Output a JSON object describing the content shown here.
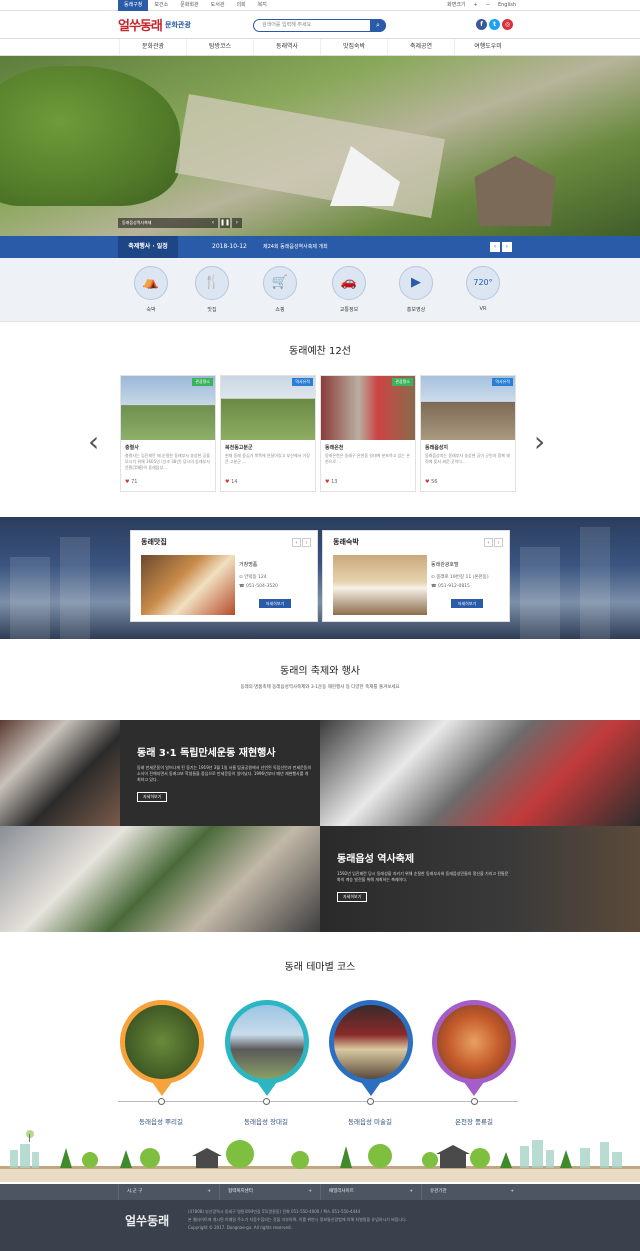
{
  "topbar": {
    "tabs": [
      "동래구청",
      "보건소",
      "문화회관",
      "도서관",
      "의회",
      "복지"
    ],
    "util": [
      "화면크기",
      "+",
      "−",
      "English"
    ]
  },
  "header": {
    "logo_script": "얼쑤동래",
    "logo_text": "문화관광",
    "search_placeholder": "검색어를 입력해 주세요",
    "search_icon": "search-icon",
    "sns": [
      {
        "label": "f",
        "color": "#3b5998"
      },
      {
        "label": "t",
        "color": "#1da1f2"
      },
      {
        "label": "◎",
        "color": "#d8333b"
      }
    ]
  },
  "gnb": [
    "문화관광",
    "탐방코스",
    "동래역사",
    "맛집숙박",
    "축제공연",
    "여행도우미"
  ],
  "hero": {
    "caption": "동래읍성역사축제",
    "controls": [
      "‹",
      "❚❚",
      "›"
    ]
  },
  "notice": {
    "label": "축제행사 · 일정",
    "date": "2018-10-12",
    "title": "제24회 동래읍성역사축제 개최",
    "arrows": [
      "‹",
      "›"
    ]
  },
  "quick": [
    {
      "label": "숙박",
      "icon": "⛺"
    },
    {
      "label": "맛집",
      "icon": "🍴"
    },
    {
      "label": "쇼핑",
      "icon": "🛒"
    },
    {
      "label": "교통정보",
      "icon": "🚗"
    },
    {
      "label": "홍보영상",
      "icon": "▶"
    },
    {
      "label": "VR",
      "icon": "720°"
    }
  ],
  "section_attractions": {
    "title": "동래예찬 12선",
    "cards": [
      {
        "badge": "관광명소",
        "badge_color": "#3bb25b",
        "name": "충렬사",
        "desc": "충렬사는 임진왜란 때 순절한 동래부사 송상현 공을 모시기 위해 1605년 (선조 38년) 당시의 동래부사 윤훤(尹暄)이 동래읍성...",
        "likes": "71",
        "img1": "#9bb8d9",
        "img2": "#6e8f4f"
      },
      {
        "badge": "역사유적",
        "badge_color": "#2a7fd4",
        "name": "복천동고분군",
        "desc": "현재 동래 중심가 북쪽에 연달아있고 부산에서 가장 큰 고분군 ...",
        "likes": "14",
        "img1": "#c9d6e3",
        "img2": "#6a8a45"
      },
      {
        "badge": "관광명소",
        "badge_color": "#3bb25b",
        "name": "동래온천",
        "desc": "동래온천은 동래구 온천동 일대에 분포하고 있는 온천으로 ...",
        "likes": "13",
        "img1": "#b9b0a0",
        "img2": "#8a3b3b"
      },
      {
        "badge": "역사유적",
        "badge_color": "#2a7fd4",
        "name": "동래읍성지",
        "desc": "동래읍성지는 동래부사 송상현 공이 군민과 함께 왜적에 맞서 싸운 곳이다...",
        "likes": "56",
        "img1": "#a7c1dd",
        "img2": "#7d6a55"
      }
    ]
  },
  "panels": [
    {
      "title": "동래맛집",
      "name": "거창명품",
      "addr": "안락동 124",
      "tel": "051-504-3520",
      "button": "자세히보기"
    },
    {
      "title": "동래숙박",
      "name": "동래관광호텔",
      "addr": "중래로 19번길 11 (온천동)",
      "tel": "051-912-0815",
      "button": "자세히보기"
    }
  ],
  "section_festival": {
    "title": "동래의 축제와 행사",
    "sub": "동래의 명품축제 동래읍성역사축제와 3·1운동 재현행사 등 다양한 축제를 즐겨보세요",
    "items": [
      {
        "title": "동래 3·1 독립만세운동 재현행사",
        "desc": "동래 만세운동이 일어나게 된 동기는 1919년 3월 1일 서울 탑골공원에서 선언된 독립선언과 만세운동의 소식이 전해지면서 동래고보 학생들을 중심으로 만세운동이 일어났다. 1996년부터 매년 재현행사를 개최하고 있다.",
        "button": "자세히보기"
      },
      {
        "title": "동래읍성 역사축제",
        "desc": "1592년 임진왜란 당시 동래성을 지키기 위해 순절한 동래부사와 동래읍성민들의 정신을 기리고 전통문화의 계승 발전을 위해 개최하는 축제이다.",
        "button": "자세히보기"
      }
    ]
  },
  "section_course": {
    "title": "동래 테마별 코스",
    "courses": [
      {
        "label": "동래읍성 뿌리길",
        "color": "#f7a23b"
      },
      {
        "label": "동래읍성 장대길",
        "color": "#2ab6c2"
      },
      {
        "label": "동래읍성 미술길",
        "color": "#2a6fc1"
      },
      {
        "label": "온천장 풍류길",
        "color": "#a55ec9"
      }
    ]
  },
  "foot_links": [
    "시,군 구",
    "협력복지센터",
    "패밀리사이트",
    "유관기관"
  ],
  "footer": {
    "logo": "얼쑤동래",
    "addr": "(47808) 부산광역시 동래구 명륜로94번길 55(명륜동) 전화 051-550-4000 / 팩스 051-550-4444",
    "notice": "본 웹사이트에 게시된 이메일 주소가 자동수집되는 것을 거부하며, 이를 위반시 정보통신망법에 의해 처벌됨을 유념하시기 바랍니다.",
    "copy": "Copyright © 2017. Dongnae-gu. All rights reserved."
  }
}
